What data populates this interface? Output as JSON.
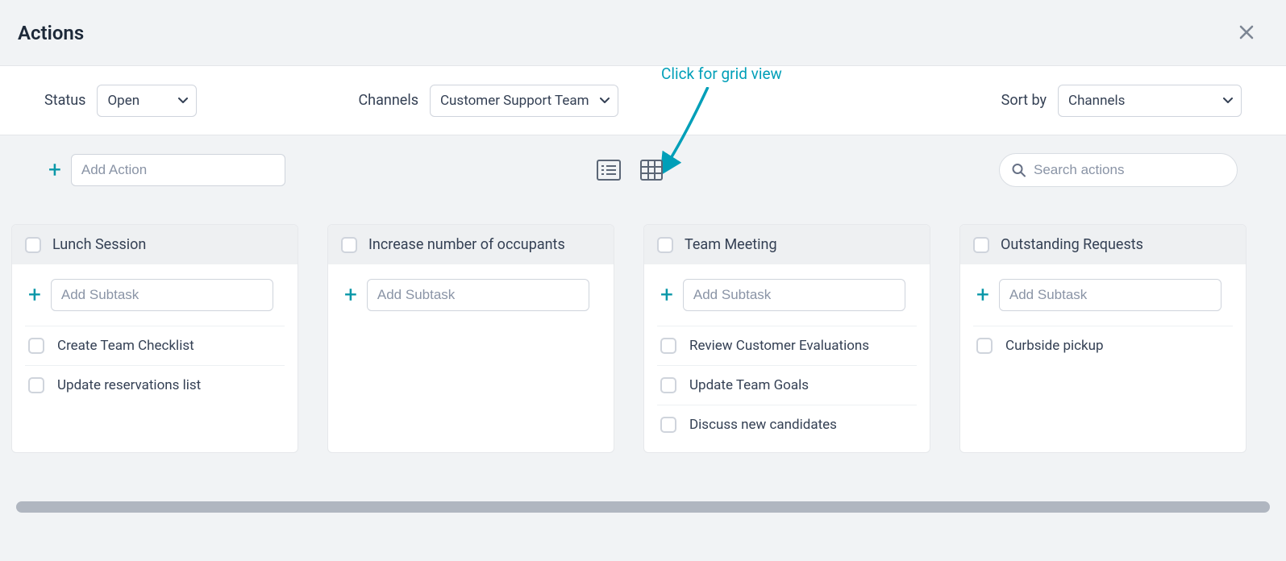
{
  "header": {
    "title": "Actions"
  },
  "filters": {
    "status_label": "Status",
    "status_value": "Open",
    "channels_label": "Channels",
    "channels_value": "Customer Support Team",
    "sort_label": "Sort by",
    "sort_value": "Channels"
  },
  "toolbar": {
    "add_action_placeholder": "Add Action",
    "search_placeholder": "Search actions"
  },
  "annotation": {
    "text": "Click for grid view"
  },
  "subtask_placeholder": "Add Subtask",
  "columns": [
    {
      "title": "Lunch Session",
      "subtasks": [
        "Create Team Checklist",
        "Update reservations list"
      ]
    },
    {
      "title": "Increase number of occupants",
      "subtasks": []
    },
    {
      "title": "Team Meeting",
      "subtasks": [
        "Review Customer Evaluations",
        "Update Team Goals",
        "Discuss new candidates"
      ]
    },
    {
      "title": "Outstanding Requests",
      "subtasks": [
        "Curbside pickup"
      ]
    }
  ]
}
